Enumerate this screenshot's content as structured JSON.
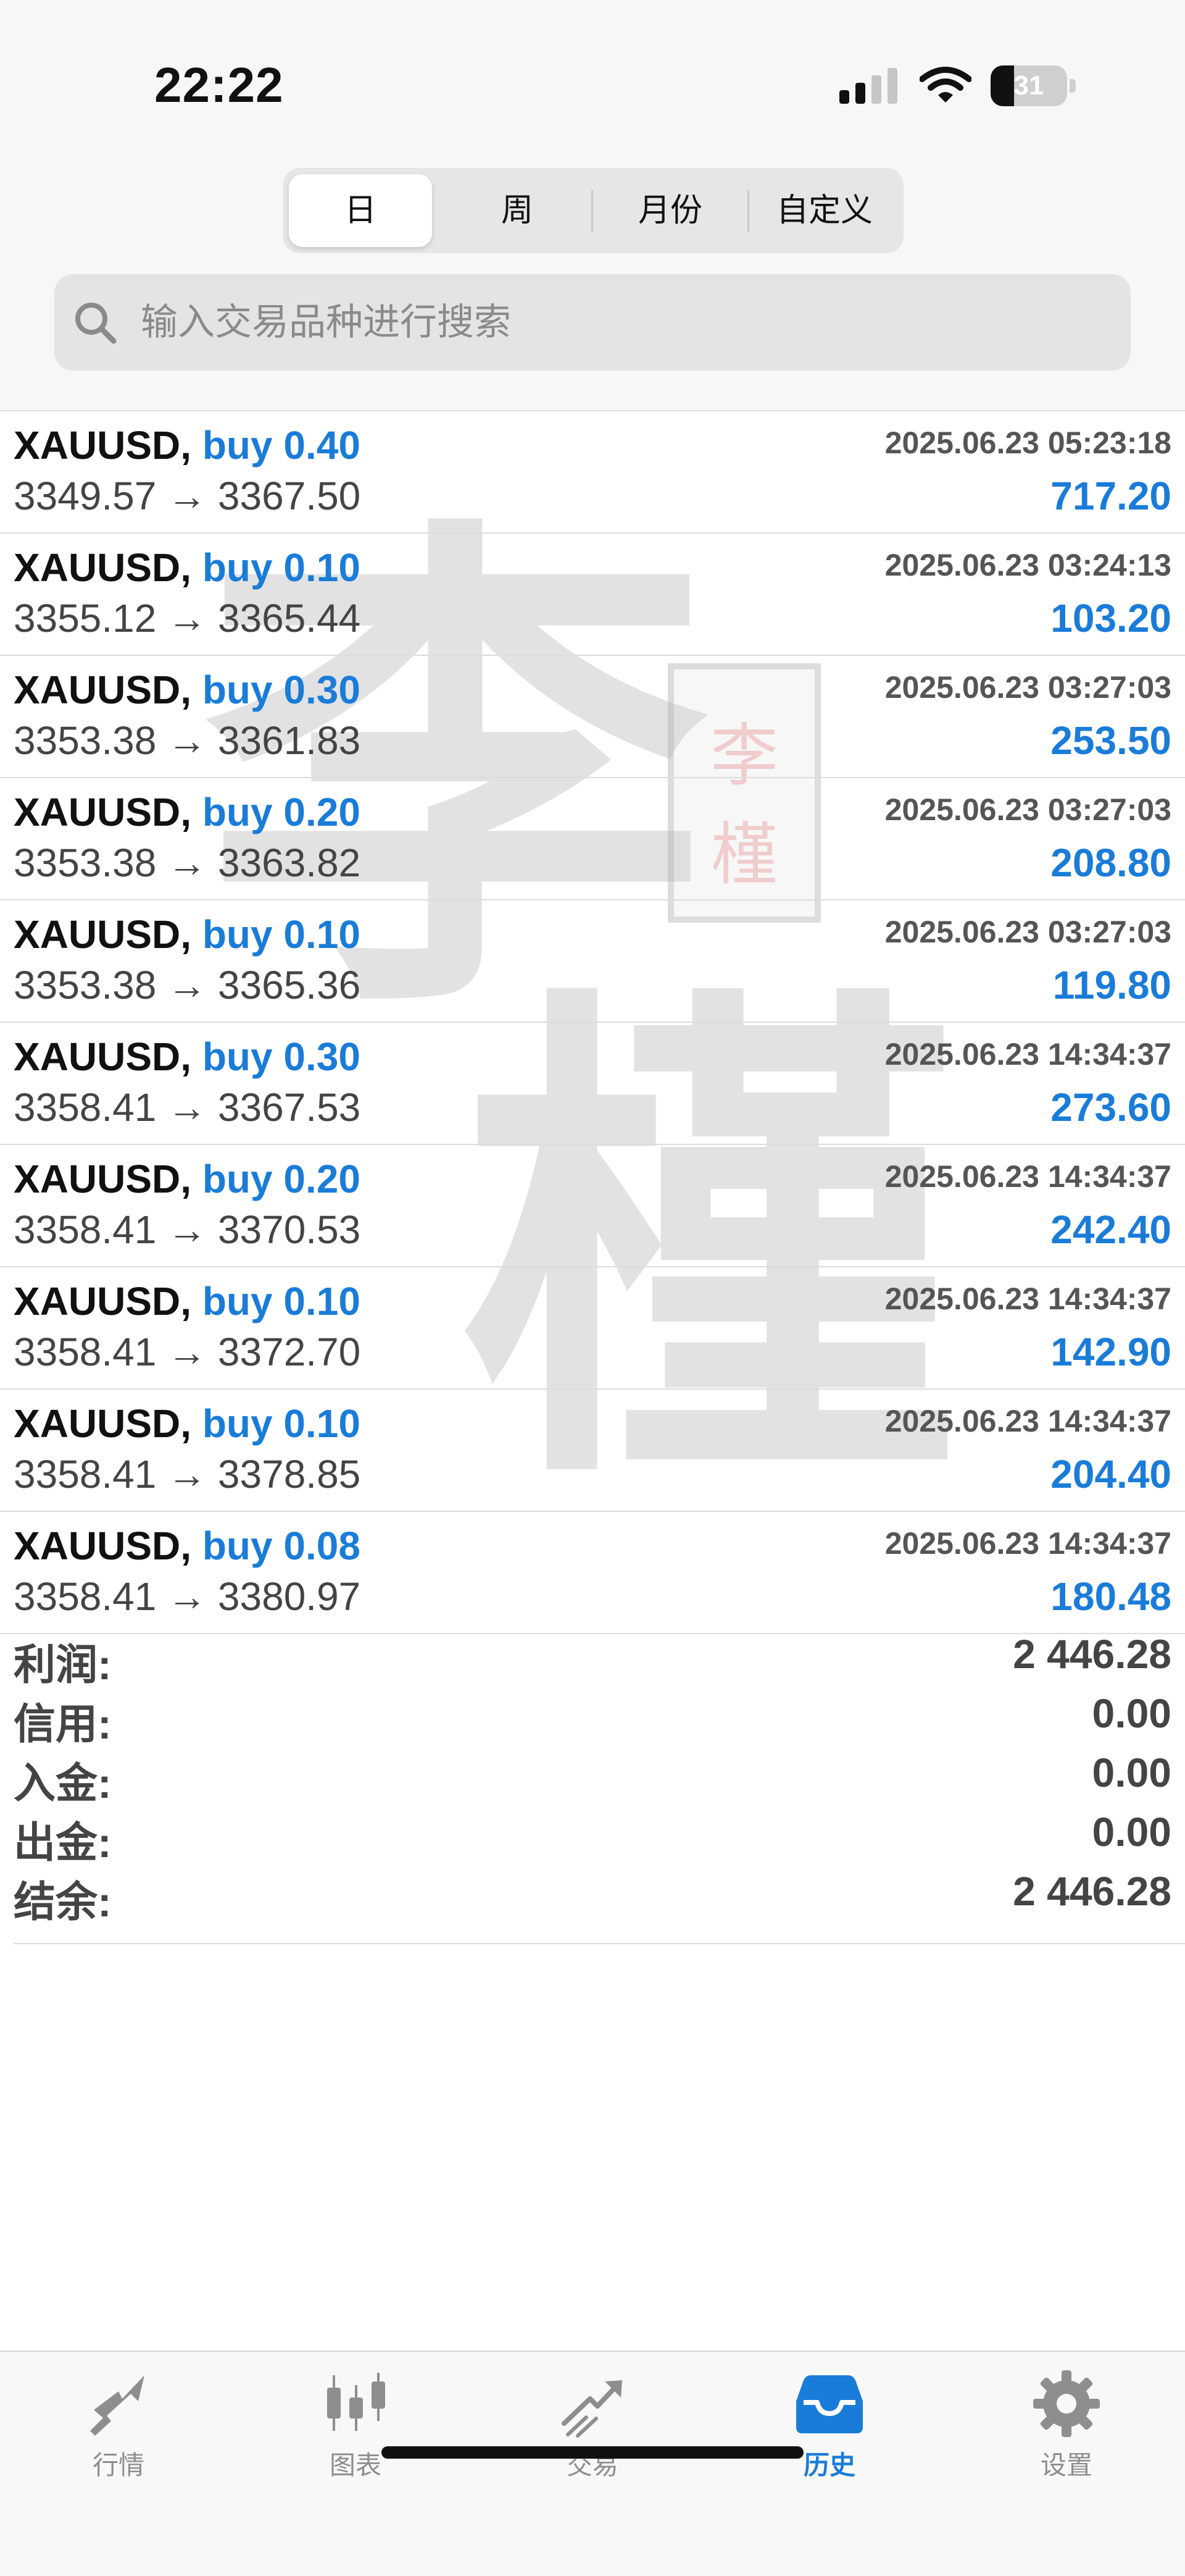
{
  "status_bar": {
    "time": "22:22",
    "battery_level": "31"
  },
  "period_tabs": [
    {
      "label": "日",
      "active": true
    },
    {
      "label": "周",
      "active": false
    },
    {
      "label": "月份",
      "active": false
    },
    {
      "label": "自定义",
      "active": false
    }
  ],
  "search": {
    "placeholder": "输入交易品种进行搜索"
  },
  "trades": [
    {
      "symbol": "XAUUSD,",
      "side": "buy 0.40",
      "time": "2025.06.23 05:23:18",
      "prices": "3349.57 → 3367.50",
      "profit": "717.20"
    },
    {
      "symbol": "XAUUSD,",
      "side": "buy 0.10",
      "time": "2025.06.23 03:24:13",
      "prices": "3355.12 → 3365.44",
      "profit": "103.20"
    },
    {
      "symbol": "XAUUSD,",
      "side": "buy 0.30",
      "time": "2025.06.23 03:27:03",
      "prices": "3353.38 → 3361.83",
      "profit": "253.50"
    },
    {
      "symbol": "XAUUSD,",
      "side": "buy 0.20",
      "time": "2025.06.23 03:27:03",
      "prices": "3353.38 → 3363.82",
      "profit": "208.80"
    },
    {
      "symbol": "XAUUSD,",
      "side": "buy 0.10",
      "time": "2025.06.23 03:27:03",
      "prices": "3353.38 → 3365.36",
      "profit": "119.80"
    },
    {
      "symbol": "XAUUSD,",
      "side": "buy 0.30",
      "time": "2025.06.23 14:34:37",
      "prices": "3358.41 → 3367.53",
      "profit": "273.60"
    },
    {
      "symbol": "XAUUSD,",
      "side": "buy 0.20",
      "time": "2025.06.23 14:34:37",
      "prices": "3358.41 → 3370.53",
      "profit": "242.40"
    },
    {
      "symbol": "XAUUSD,",
      "side": "buy 0.10",
      "time": "2025.06.23 14:34:37",
      "prices": "3358.41 → 3372.70",
      "profit": "142.90"
    },
    {
      "symbol": "XAUUSD,",
      "side": "buy 0.10",
      "time": "2025.06.23 14:34:37",
      "prices": "3358.41 → 3378.85",
      "profit": "204.40"
    },
    {
      "symbol": "XAUUSD,",
      "side": "buy 0.08",
      "time": "2025.06.23 14:34:37",
      "prices": "3358.41 → 3380.97",
      "profit": "180.48"
    }
  ],
  "summary": [
    {
      "label": "利润:",
      "value": "2 446.28"
    },
    {
      "label": "信用:",
      "value": "0.00"
    },
    {
      "label": "入金:",
      "value": "0.00"
    },
    {
      "label": "出金:",
      "value": "0.00"
    },
    {
      "label": "结余:",
      "value": "2 446.28"
    }
  ],
  "watermark": {
    "chars": [
      "李",
      "槿"
    ]
  },
  "tab_bar": [
    {
      "label": "行情",
      "icon": "quotes-icon",
      "active": false
    },
    {
      "label": "图表",
      "icon": "chart-icon",
      "active": false
    },
    {
      "label": "交易",
      "icon": "trade-icon",
      "active": false
    },
    {
      "label": "历史",
      "icon": "history-icon",
      "active": true
    },
    {
      "label": "设置",
      "icon": "settings-icon",
      "active": false
    }
  ],
  "colors": {
    "accent": "#1a7cd9",
    "inactive": "#8e8e8e",
    "text": "#111111"
  }
}
